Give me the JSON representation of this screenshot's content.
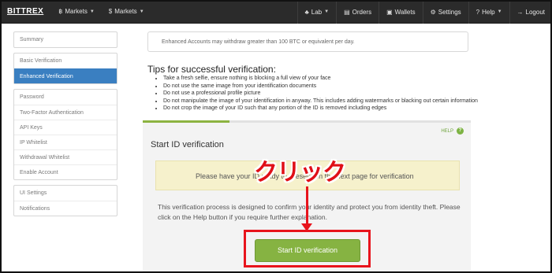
{
  "navbar": {
    "brand": "BITTREX",
    "left": [
      {
        "icon": "bitcoin-icon",
        "glyph": "฿",
        "label": "Markets"
      },
      {
        "icon": "dollar-icon",
        "glyph": "$",
        "label": "Markets"
      }
    ],
    "right": [
      {
        "icon": "flask-icon",
        "glyph": "♣",
        "label": "Lab",
        "caret": true
      },
      {
        "icon": "orders-icon",
        "glyph": "▤",
        "label": "Orders",
        "caret": false
      },
      {
        "icon": "wallet-icon",
        "glyph": "▣",
        "label": "Wallets",
        "caret": false
      },
      {
        "icon": "gear-icon",
        "glyph": "⚙",
        "label": "Settings",
        "caret": false
      },
      {
        "icon": "help-icon",
        "glyph": "?",
        "label": "Help",
        "caret": true
      },
      {
        "icon": "logout-icon",
        "glyph": "→",
        "label": "Logout",
        "caret": false
      }
    ]
  },
  "sidebar": {
    "groups": [
      [
        "Summary"
      ],
      [
        "Basic Verification",
        "Enhanced Verification"
      ],
      [
        "Password",
        "Two-Factor Authentication",
        "API Keys",
        "IP Whitelist",
        "Withdrawal Whitelist",
        "Enable Account"
      ],
      [
        "UI Settings",
        "Notifications"
      ]
    ],
    "active": "Enhanced Verification"
  },
  "notice": "Enhanced Accounts may withdraw greater than 100 BTC or equivalent per day.",
  "tips": {
    "title": "Tips for successful verification:",
    "items": [
      "Take a fresh selfie, ensure nothing is blocking a full view of your face",
      "Do not use the same image from your identification documents",
      "Do not use a professional profile picture",
      "Do not manipulate the image of your identification in anyway. This includes adding watermarks or blacking out certain information",
      "Do not crop the image of your ID such that any portion of the ID is removed including edges"
    ]
  },
  "progress_fraction": 0.265,
  "panel": {
    "help_label": "HELP",
    "title": "Start ID verification",
    "alert": "Please have your ID ready to present on the next page for verification",
    "description": "This verification process is designed to confirm your identity and protect you from identity theft. Please click on the Help button if you require further explanation.",
    "button_label": "Start ID verification"
  },
  "annotation": {
    "text": "クリック",
    "color": "#e00f17"
  },
  "colors": {
    "navbar": "#2b2b2b",
    "active": "#3a7fc1",
    "accent_green": "#86b342",
    "alert_bg": "#f6f1cc",
    "highlight_red": "#e8141c"
  }
}
